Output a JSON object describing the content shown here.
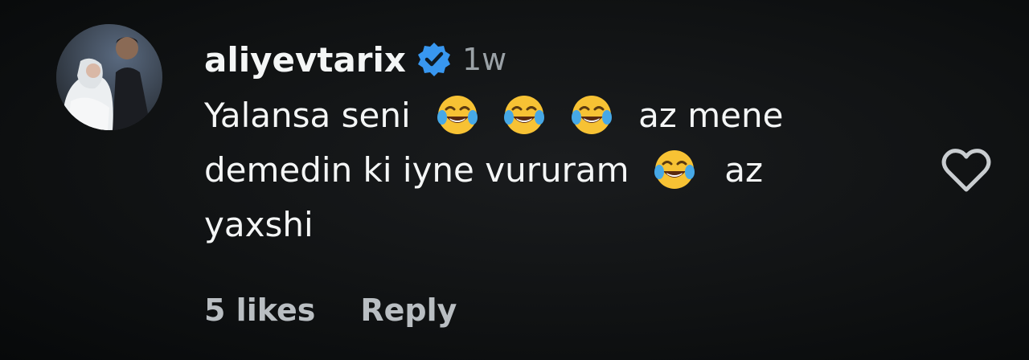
{
  "comment": {
    "username": "aliyevtarix",
    "verified_icon": "verified-badge-icon",
    "time": "1w",
    "text": {
      "line1_a": "Yalansa seni",
      "line1_b": "az mene",
      "line2_a": "demedin ki iyne vururam",
      "line2_b": "az",
      "line3": "yaxshi"
    },
    "emoji_icon": "face-with-tears-of-joy-icon",
    "likes": "5 likes",
    "reply_label": "Reply",
    "like_icon": "heart-outline-icon"
  },
  "colors": {
    "background": "#101213",
    "text": "#f4f6f6",
    "muted": "#9aa1a6",
    "verified": "#3897f0"
  }
}
